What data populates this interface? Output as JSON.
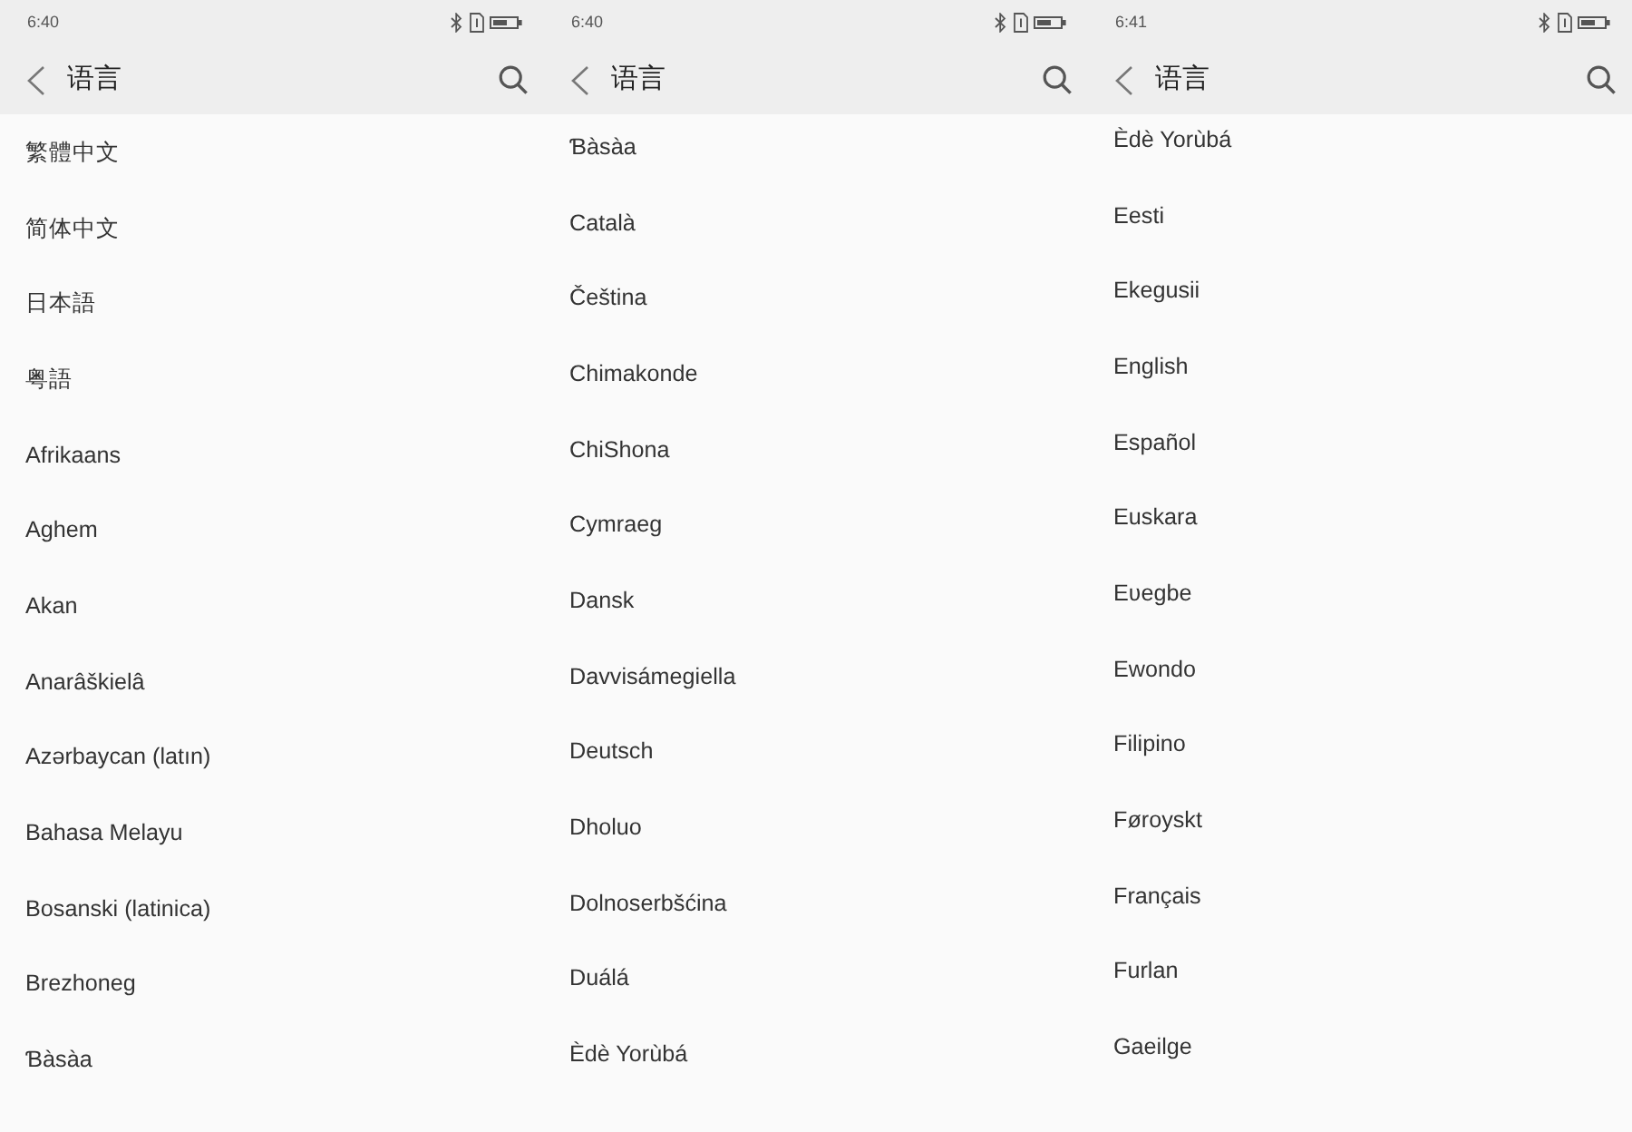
{
  "screens": [
    {
      "status_bar": {
        "time": "6:40"
      },
      "header": {
        "title": "语言"
      },
      "languages": [
        "繁體中文",
        "简体中文",
        "日本語",
        "粤語",
        "Afrikaans",
        "Aghem",
        "Akan",
        "Anarâškielâ",
        "Azərbaycan (latın)",
        "Bahasa Melayu",
        "Bosanski (latinica)",
        "Brezhoneg",
        "Ɓàsàa"
      ]
    },
    {
      "status_bar": {
        "time": "6:40"
      },
      "header": {
        "title": "语言"
      },
      "languages": [
        "Ɓàsàa",
        "Català",
        "Čeština",
        "Chimakonde",
        "ChiShona",
        "Cymraeg",
        "Dansk",
        "Davvisámegiella",
        "Deutsch",
        "Dholuo",
        "Dolnoserbšćina",
        "Duálá",
        "Èdè Yorùbá"
      ]
    },
    {
      "status_bar": {
        "time": "6:41"
      },
      "header": {
        "title": "语言"
      },
      "languages": [
        "Èdè Yorùbá",
        "Eesti",
        "Ekegusii",
        "English",
        "Español",
        "Euskara",
        "Eʋegbe",
        "Ewondo",
        "Filipino",
        "Føroyskt",
        "Français",
        "Furlan",
        "Gaeilge"
      ]
    }
  ]
}
